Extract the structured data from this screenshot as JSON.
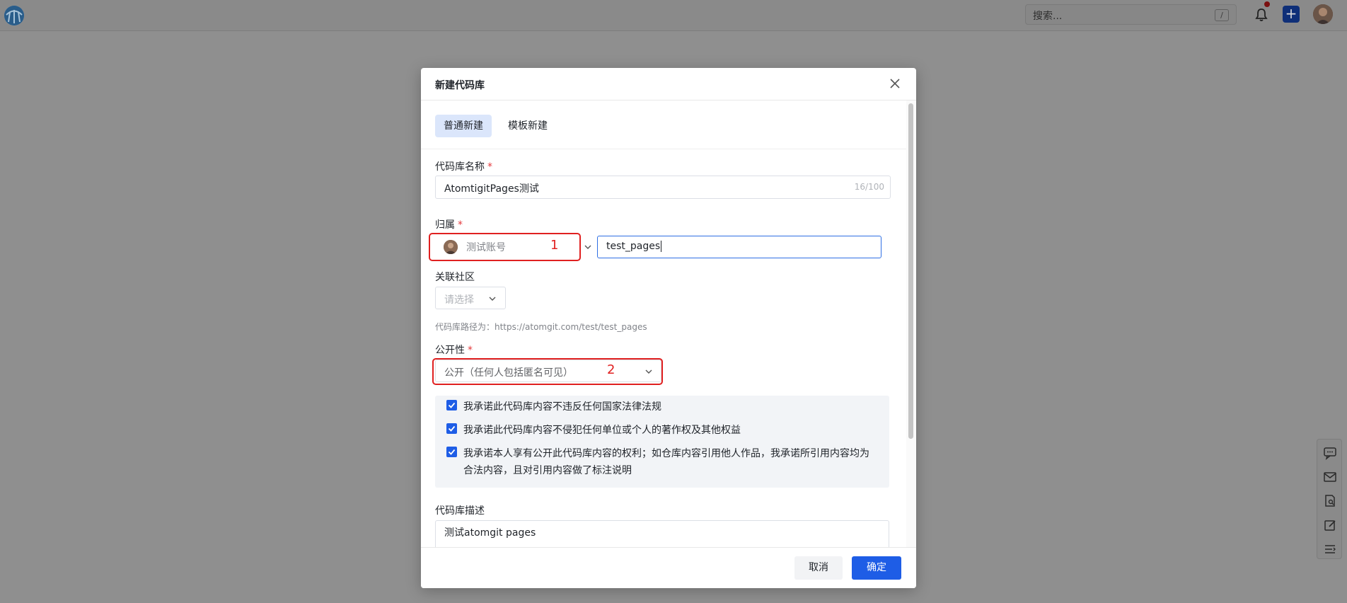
{
  "topbar": {
    "search_placeholder": "搜索...",
    "search_shortcut": "/",
    "add_label": "+"
  },
  "dialog": {
    "title": "新建代码库",
    "tabs": [
      {
        "label": "普通新建",
        "active": true
      },
      {
        "label": "模板新建",
        "active": false
      }
    ],
    "name_field": {
      "label": "代码库名称",
      "required_mark": "*",
      "value": "AtomtigitPages测试",
      "counter": "16/100"
    },
    "owner_field": {
      "label": "归属",
      "required_mark": "*",
      "owner": "测试账号",
      "path_value": "test_pages"
    },
    "community_field": {
      "label": "关联社区",
      "placeholder": "请选择"
    },
    "path_hint": "代码库路径为：https://atomgit.com/test/test_pages",
    "visibility_field": {
      "label": "公开性",
      "required_mark": "*",
      "value": "公开（任何人包括匿名可见）"
    },
    "promises": [
      {
        "text": "我承诺此代码库内容不违反任何国家法律法规",
        "checked": true
      },
      {
        "text": "我承诺此代码库内容不侵犯任何单位或个人的著作权及其他权益",
        "checked": true
      },
      {
        "text": "我承诺本人享有公开此代码库内容的权利；如仓库内容引用他人作品，我承诺所引用内容均为合法内容，且对引用内容做了标注说明",
        "checked": true
      }
    ],
    "description_field": {
      "label": "代码库描述",
      "value": "测试atomgit pages"
    },
    "cancel_label": "取消",
    "ok_label": "确定"
  },
  "annotations": [
    {
      "number": "1"
    },
    {
      "number": "2"
    }
  ],
  "colors": {
    "primary": "#1e5de6",
    "annotation": "#e02020",
    "required": "#e4393c",
    "tab_active_bg": "#dbe6fb"
  }
}
